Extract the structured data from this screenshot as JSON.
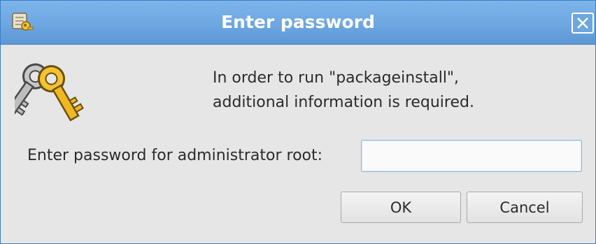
{
  "window": {
    "title": "Enter password",
    "app_icon": "key-app-icon",
    "close_icon": "close-icon"
  },
  "dialog": {
    "icon": "keys-icon",
    "message_line1": "In order to run \"packageinstall\",",
    "message_line2": "additional information is required.",
    "password_label": "Enter password for administrator root:",
    "password_value": "",
    "password_placeholder": ""
  },
  "buttons": {
    "ok_label": "OK",
    "cancel_label": "Cancel"
  },
  "colors": {
    "titlebar": "#6fa8e2",
    "title_text": "#ffffff",
    "background": "#e6e6e6",
    "input_border": "#8fb7e3"
  }
}
